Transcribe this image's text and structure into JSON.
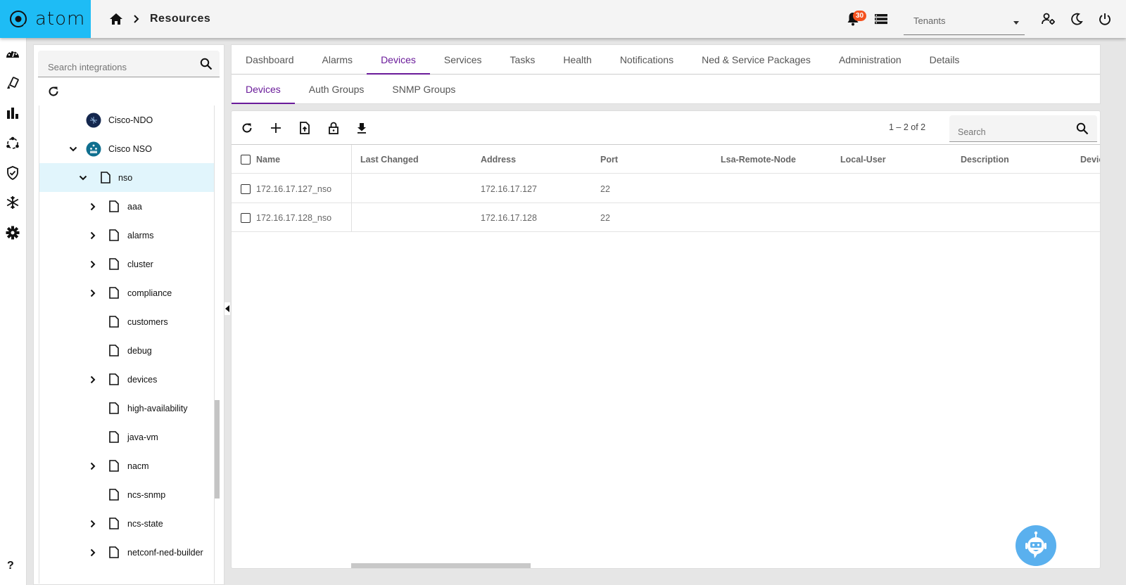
{
  "header": {
    "app_name": "atom",
    "breadcrumb": "Resources",
    "notification_count": "30",
    "tenant_placeholder": "Tenants"
  },
  "left_nav": {
    "items": [
      "dashboard-icon",
      "resources-icon",
      "analytics-icon",
      "orchestration-icon",
      "security-icon",
      "snowflake-icon",
      "settings-icon"
    ],
    "help": "?"
  },
  "integration_panel": {
    "search_placeholder": "Search integrations",
    "tree": [
      {
        "label": "Cisco-NDO",
        "type": "integration",
        "expanded": null
      },
      {
        "label": "Cisco NSO",
        "type": "integration",
        "expanded": true
      },
      {
        "label": "nso",
        "type": "file",
        "expanded": true,
        "selected": true
      },
      {
        "label": "aaa",
        "type": "file",
        "expanded": false
      },
      {
        "label": "alarms",
        "type": "file",
        "expanded": false
      },
      {
        "label": "cluster",
        "type": "file",
        "expanded": false
      },
      {
        "label": "compliance",
        "type": "file",
        "expanded": false
      },
      {
        "label": "customers",
        "type": "file",
        "expanded": null
      },
      {
        "label": "debug",
        "type": "file",
        "expanded": null
      },
      {
        "label": "devices",
        "type": "file",
        "expanded": false
      },
      {
        "label": "high-availability",
        "type": "file",
        "expanded": null
      },
      {
        "label": "java-vm",
        "type": "file",
        "expanded": null
      },
      {
        "label": "nacm",
        "type": "file",
        "expanded": false
      },
      {
        "label": "ncs-snmp",
        "type": "file",
        "expanded": null
      },
      {
        "label": "ncs-state",
        "type": "file",
        "expanded": false
      },
      {
        "label": "netconf-ned-builder",
        "type": "file",
        "expanded": false
      }
    ]
  },
  "tabs": {
    "primary": [
      "Dashboard",
      "Alarms",
      "Devices",
      "Services",
      "Tasks",
      "Health",
      "Notifications",
      "Ned & Service Packages",
      "Administration",
      "Details"
    ],
    "primary_active": "Devices",
    "secondary": [
      "Devices",
      "Auth Groups",
      "SNMP Groups"
    ],
    "secondary_active": "Devices"
  },
  "table": {
    "pagination": "1 – 2 of 2",
    "search_placeholder": "Search",
    "columns": [
      "Name",
      "Last Changed",
      "Address",
      "Port",
      "Lsa-Remote-Node",
      "Local-User",
      "Description",
      "Devic"
    ],
    "rows": [
      {
        "name": "172.16.17.127_nso",
        "last_changed": "",
        "address": "172.16.17.127",
        "port": "22",
        "lsa_remote_node": "",
        "local_user": "",
        "description": ""
      },
      {
        "name": "172.16.17.128_nso",
        "last_changed": "",
        "address": "172.16.17.128",
        "port": "22",
        "lsa_remote_node": "",
        "local_user": "",
        "description": ""
      }
    ]
  },
  "colors": {
    "brand": "#1ebcf5",
    "accent": "#6a1b9a",
    "link": "#1e9bd7",
    "badge": "#f4511e",
    "selected_row": "#e1f5fc",
    "bot": "#5ab0ee"
  }
}
